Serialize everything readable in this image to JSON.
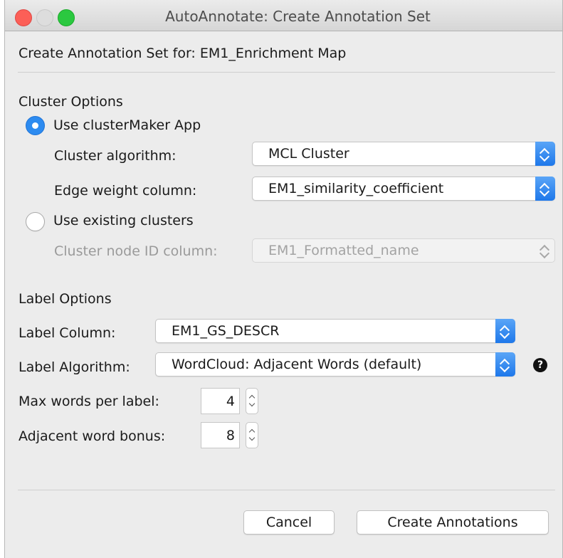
{
  "window": {
    "title": "AutoAnnotate: Create Annotation Set"
  },
  "header": {
    "text": "Create Annotation Set for: EM1_Enrichment Map"
  },
  "cluster_options": {
    "heading": "Cluster Options",
    "use_clustermaker_label": "Use clusterMaker App",
    "use_clustermaker_selected": true,
    "cluster_algorithm_label": "Cluster algorithm:",
    "cluster_algorithm_value": "MCL Cluster",
    "edge_weight_label": "Edge weight column:",
    "edge_weight_value": "EM1_similarity_coefficient",
    "use_existing_label": "Use existing clusters",
    "use_existing_selected": false,
    "cluster_node_id_label": "Cluster node ID column:",
    "cluster_node_id_value": "EM1_Formatted_name"
  },
  "label_options": {
    "heading": "Label Options",
    "label_column_label": "Label Column:",
    "label_column_value": "EM1_GS_DESCR",
    "label_algorithm_label": "Label Algorithm:",
    "label_algorithm_value": "WordCloud: Adjacent Words (default)",
    "help_icon": "question-circle-icon",
    "max_words_label": "Max words per label:",
    "max_words_value": "4",
    "adjacent_bonus_label": "Adjacent word bonus:",
    "adjacent_bonus_value": "8"
  },
  "buttons": {
    "cancel": "Cancel",
    "create": "Create Annotations"
  },
  "colors": {
    "accent": "#2d8bf0",
    "close": "#fc5f57",
    "maximize": "#2bc840"
  }
}
